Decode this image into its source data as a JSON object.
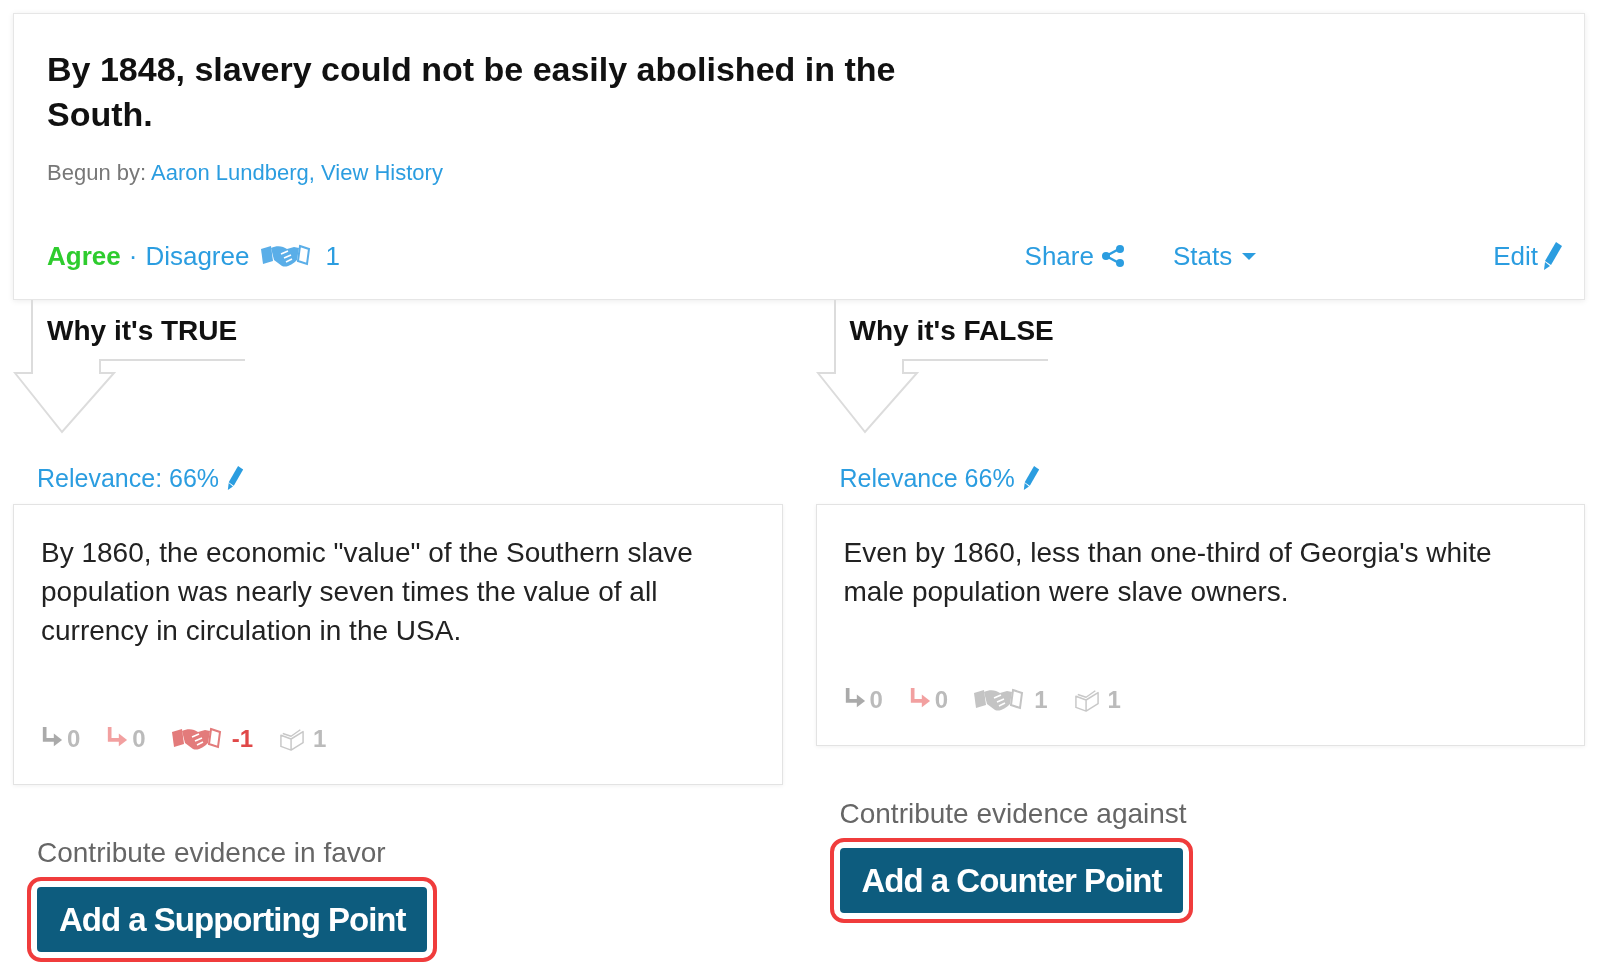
{
  "claim": {
    "title": "By 1848, slavery could not be easily abolished in the South.",
    "begun_by": {
      "label": "Begun by:",
      "author": "Aaron Lundberg",
      "separator": ",",
      "history_link": "View History"
    },
    "votes": [
      {
        "label": "Agree",
        "selected": true
      },
      {
        "label": "Disagree",
        "selected": false
      }
    ],
    "vote_separator": "·",
    "agreement_count": "1",
    "actions": [
      {
        "kind": "share",
        "label": "Share"
      },
      {
        "kind": "stats",
        "label": "Stats"
      }
    ],
    "edit": {
      "label": "Edit"
    }
  },
  "columns": [
    {
      "heading": "Why it's TRUE",
      "relevance": "Relevance: 66%",
      "points": [
        {
          "text": "By 1860, the economic \"value\" of the Southern slave population was nearly seven times the value of all currency in circulation in the USA.",
          "stats": [
            {
              "kind": "supporting",
              "count": "0"
            },
            {
              "kind": "counter",
              "count": "0"
            },
            {
              "kind": "agreement",
              "count": "-1",
              "negative": true
            },
            {
              "kind": "sources",
              "count": "1"
            }
          ]
        }
      ],
      "prompt": "Contribute evidence in favor",
      "button": {
        "label": "Add a Supporting Point",
        "highlighted": true
      }
    },
    {
      "heading": "Why it's FALSE",
      "relevance": "Relevance 66%",
      "points": [
        {
          "text": "Even by 1860, less than one-third of Georgia's white male population were slave owners.",
          "stats": [
            {
              "kind": "supporting",
              "count": "0"
            },
            {
              "kind": "counter",
              "count": "0"
            },
            {
              "kind": "agreement",
              "count": "1",
              "negative": false
            },
            {
              "kind": "sources",
              "count": "1"
            }
          ]
        }
      ],
      "prompt": "Contribute evidence against",
      "button": {
        "label": "Add a Counter Point",
        "highlighted": true
      }
    }
  ]
}
